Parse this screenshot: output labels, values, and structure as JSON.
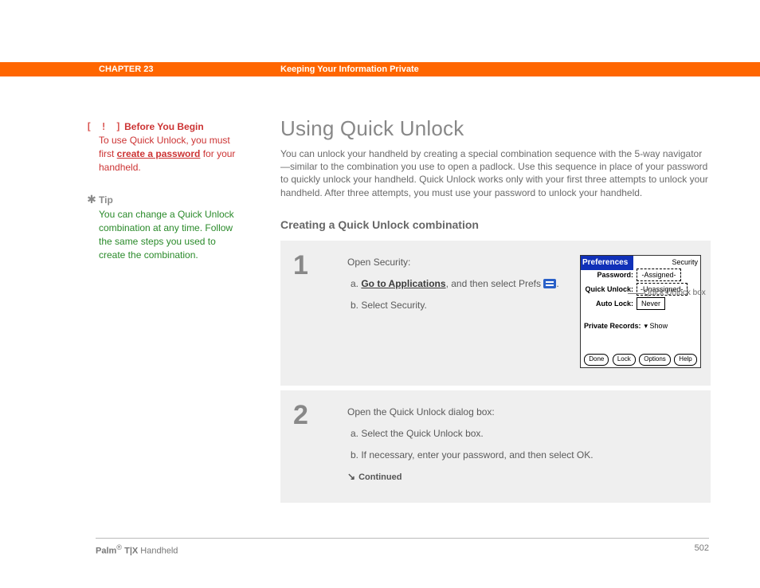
{
  "header": {
    "chapter": "CHAPTER 23",
    "title": "Keeping Your Information Private"
  },
  "sidebar": {
    "before_you_begin": {
      "icon": "[ ! ]",
      "label": "Before You Begin",
      "text_pre": "To use Quick Unlock, you must first ",
      "link": "create a password",
      "text_post": " for your handheld."
    },
    "tip": {
      "icon": "✱",
      "label": "Tip",
      "text": "You can change a Quick Unlock combination at any time. Follow the same steps you used to create the combination."
    }
  },
  "main": {
    "heading": "Using Quick Unlock",
    "intro": "You can unlock your handheld by creating a special combination sequence with the 5-way navigator—similar to the combination you use to open a padlock. Use this sequence in place of your password to quickly unlock your handheld. Quick Unlock works only with your first three attempts to unlock your handheld. After three attempts, you must use your password to unlock your handheld.",
    "subheading": "Creating a Quick Unlock combination",
    "steps": [
      {
        "num": "1",
        "lead": "Open Security:",
        "a_pre": "a.  ",
        "a_link": "Go to Applications",
        "a_mid": ", and then select Prefs ",
        "a_post": ".",
        "b": "b.  Select Security."
      },
      {
        "num": "2",
        "lead": "Open the Quick Unlock dialog box:",
        "a": "a.   Select the Quick Unlock box.",
        "b": "b.   If necessary, enter your password, and then select OK.",
        "cont_arrow": "↘",
        "cont": "Continued"
      }
    ]
  },
  "palmshot": {
    "title": "Preferences",
    "category": "Security",
    "rows": {
      "password_label": "Password:",
      "password_value": "-Assigned-",
      "quick_label": "Quick Unlock:",
      "quick_value": "-Unassigned-",
      "auto_label": "Auto Lock:",
      "auto_value": "Never",
      "private_label": "Private Records:",
      "private_value": "▾ Show"
    },
    "buttons": [
      "Done",
      "Lock",
      "Options",
      "Help"
    ]
  },
  "callout": "Quick Unlock box",
  "footer": {
    "brand": "Palm",
    "reg": "®",
    "model": " T|X ",
    "type": "Handheld",
    "page": "502"
  }
}
